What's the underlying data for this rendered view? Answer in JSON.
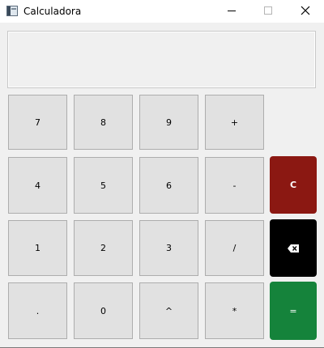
{
  "window": {
    "title": "Calculadora",
    "icon": "calculator-app-icon",
    "controls": [
      "minimize-icon",
      "maximize-icon",
      "close-icon"
    ]
  },
  "display": {
    "value": ""
  },
  "keypad": {
    "row1": [
      "7",
      "8",
      "9",
      "+"
    ],
    "row2": [
      "4",
      "5",
      "6",
      "-"
    ],
    "row3": [
      "1",
      "2",
      "3",
      "/"
    ],
    "row4": [
      ".",
      "0",
      "^",
      "*"
    ]
  },
  "side_keys": {
    "clear_label": "C",
    "backspace_icon": "backspace-icon",
    "equals_label": "="
  },
  "colors": {
    "clear_button": "#8b1812",
    "backspace_button": "#000000",
    "equals_button": "#15833b",
    "key_background": "#e1e1e1"
  }
}
